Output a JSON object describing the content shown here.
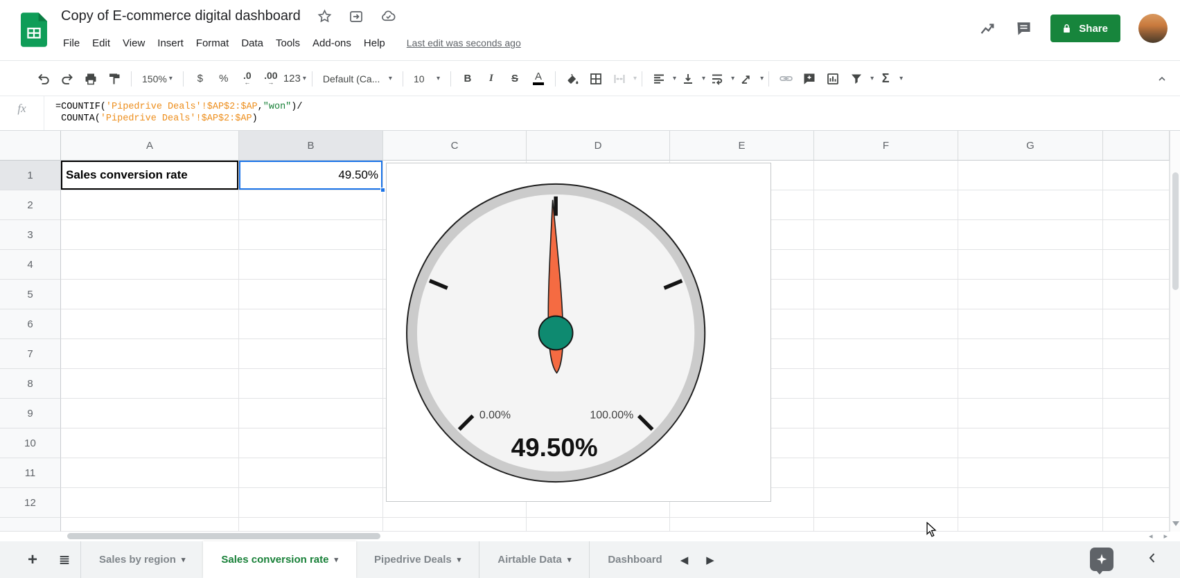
{
  "header": {
    "title": "Copy of E-commerce digital dashboard",
    "menus": [
      "File",
      "Edit",
      "View",
      "Insert",
      "Format",
      "Data",
      "Tools",
      "Add-ons",
      "Help"
    ],
    "last_edit": "Last edit was seconds ago",
    "share_label": "Share"
  },
  "toolbar": {
    "zoom": "150%",
    "currency": "$",
    "percent": "%",
    "decrease_decimals": ".0",
    "increase_decimals": ".00",
    "more_formats": "123",
    "font": "Default (Ca...",
    "font_size": "10",
    "bold": "B",
    "italic": "I",
    "strikethrough": "S",
    "text_color": "A",
    "sum": "Σ"
  },
  "formula_bar": {
    "fx": "fx",
    "line1": {
      "a": "=COUNTIF(",
      "b": "'Pipedrive Deals'!$AP$2:$AP",
      "c": ",",
      "d": "\"won\"",
      "e": ")/"
    },
    "line2": {
      "a": " COUNTA(",
      "b": "'Pipedrive Deals'!$AP$2:$AP",
      "c": ")"
    }
  },
  "grid": {
    "column_headers": [
      "A",
      "B",
      "C",
      "D",
      "E",
      "F",
      "G"
    ],
    "row_headers": [
      "1",
      "2",
      "3",
      "4",
      "5",
      "6",
      "7",
      "8",
      "9",
      "10",
      "11",
      "12"
    ],
    "cells": {
      "A1": "Sales conversion rate",
      "B1": "49.50%"
    },
    "selected_cell": "B1",
    "selection_color": "#1a73e8"
  },
  "chart_data": {
    "type": "gauge",
    "value": 49.5,
    "value_label": "49.50%",
    "min": 0,
    "max": 100,
    "min_label": "0.00%",
    "max_label": "100.00%",
    "ticks": [
      0,
      25,
      50,
      75,
      100
    ],
    "start_angle": -135,
    "sweep_angle": 270,
    "needle_color": "#f56b42",
    "hub_color": "#0e8a70",
    "face_color": "#f4f4f4",
    "ring_color": "#cbcbcb"
  },
  "sheet_tabs": {
    "active_color": "#188038",
    "items": [
      {
        "label": "Sales by region",
        "active": false,
        "has_menu": true,
        "clipped": false
      },
      {
        "label": "Sales conversion rate",
        "active": true,
        "has_menu": true,
        "clipped": false
      },
      {
        "label": "Pipedrive Deals",
        "active": false,
        "has_menu": true,
        "clipped": false
      },
      {
        "label": "Airtable Data",
        "active": false,
        "has_menu": true,
        "clipped": false
      },
      {
        "label": "Dashboard",
        "active": false,
        "has_menu": false,
        "clipped": true
      }
    ]
  }
}
